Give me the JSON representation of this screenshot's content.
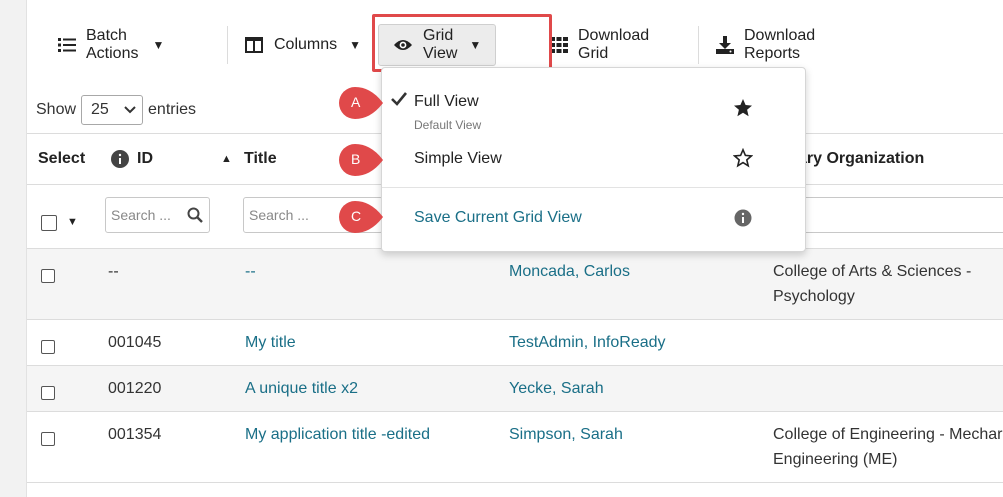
{
  "toolbar": {
    "batch_actions": "Batch Actions",
    "columns": "Columns",
    "grid_view": "Grid View",
    "download_grid": "Download Grid",
    "download_reports": "Download Reports"
  },
  "entries": {
    "show": "Show",
    "value": "25",
    "suffix": "entries"
  },
  "table": {
    "headers": {
      "select": "Select",
      "id": "ID",
      "title": "Title",
      "org": "ary Organization"
    },
    "filters": {
      "id_placeholder": "Search ...",
      "title_placeholder": "Search ..."
    },
    "rows": [
      {
        "id": "--",
        "title": "--",
        "person": "Moncada, Carlos",
        "org": "College of Arts & Sciences -",
        "org2": "Psychology"
      },
      {
        "id": "001045",
        "title": "My title",
        "person": "TestAdmin, InfoReady",
        "org": "",
        "org2": ""
      },
      {
        "id": "001220",
        "title": "A unique title x2",
        "person": "Yecke, Sarah",
        "org": "",
        "org2": ""
      },
      {
        "id": "001354",
        "title": "My application title -edited",
        "person": "Simpson, Sarah",
        "org": "College of Engineering - Mechar",
        "org2": "Engineering (ME)"
      }
    ]
  },
  "dropdown": {
    "full_view": "Full View",
    "full_view_sub": "Default View",
    "simple_view": "Simple View",
    "save_view": "Save Current Grid View"
  },
  "badges": [
    "A",
    "B",
    "C"
  ],
  "colors": {
    "link": "#1a6f87",
    "highlight": "#e0494a",
    "badge": "#e0494a"
  }
}
